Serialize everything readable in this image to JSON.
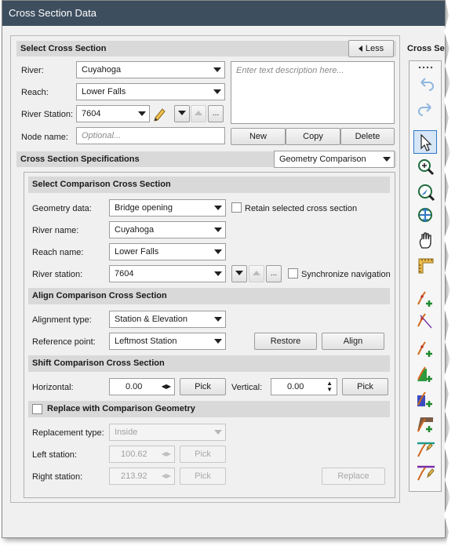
{
  "window": {
    "title": "Cross Section Data"
  },
  "select_cross_section": {
    "header": "Select Cross Section",
    "less_button": "Less",
    "river_label": "River:",
    "river_value": "Cuyahoga",
    "reach_label": "Reach:",
    "reach_value": "Lower Falls",
    "station_label": "River Station:",
    "station_value": "7604",
    "ellipsis": "...",
    "node_label": "Node name:",
    "node_placeholder": "Optional...",
    "description_placeholder": "Enter text description here...",
    "new_button": "New",
    "copy_button": "Copy",
    "delete_button": "Delete"
  },
  "specifications": {
    "header": "Cross Section Specifications",
    "mode_value": "Geometry Comparison"
  },
  "comparison": {
    "header": "Select Comparison Cross Section",
    "geometry_label": "Geometry data:",
    "geometry_value": "Bridge opening",
    "retain_label": "Retain selected cross section",
    "river_label": "River name:",
    "river_value": "Cuyahoga",
    "reach_label": "Reach name:",
    "reach_value": "Lower Falls",
    "station_label": "River station:",
    "station_value": "7604",
    "ellipsis": "...",
    "sync_label": "Synchronize navigation"
  },
  "align": {
    "header": "Align Comparison Cross Section",
    "type_label": "Alignment type:",
    "type_value": "Station & Elevation",
    "ref_label": "Reference point:",
    "ref_value": "Leftmost Station",
    "restore_button": "Restore",
    "align_button": "Align"
  },
  "shift": {
    "header": "Shift Comparison Cross Section",
    "horizontal_label": "Horizontal:",
    "horizontal_value": "0.00",
    "pick_button": "Pick",
    "vertical_label": "Vertical:",
    "vertical_value": "0.00",
    "pick_button_2": "Pick"
  },
  "replace": {
    "header": "Replace with Comparison Geometry",
    "type_label": "Replacement type:",
    "type_value": "Inside",
    "left_label": "Left station:",
    "left_value": "100.62",
    "right_label": "Right station:",
    "right_value": "213.92",
    "pick_button": "Pick",
    "pick_button_2": "Pick",
    "replace_button": "Replace"
  },
  "right_panel": {
    "title": "Cross Se"
  },
  "toolbar": {
    "icons": [
      "more-icon",
      "undo-icon",
      "redo-icon",
      "select-arrow-icon",
      "zoom-icon",
      "pan-zoom-icon",
      "zoom-extents-icon",
      "hand-icon",
      "measure-icon",
      "add-point-icon",
      "line-tool-icon",
      "bank-station-icon",
      "levee-icon",
      "ineffective-area-icon",
      "blocked-obstruction-icon",
      "lid-icon",
      "pencil-profile-icon",
      "pencil-profile-2-icon"
    ]
  },
  "colors": {
    "title_bar": "#3d4e5f",
    "accent_blue": "#2e78c6",
    "section_header": "#d9d9d9"
  }
}
